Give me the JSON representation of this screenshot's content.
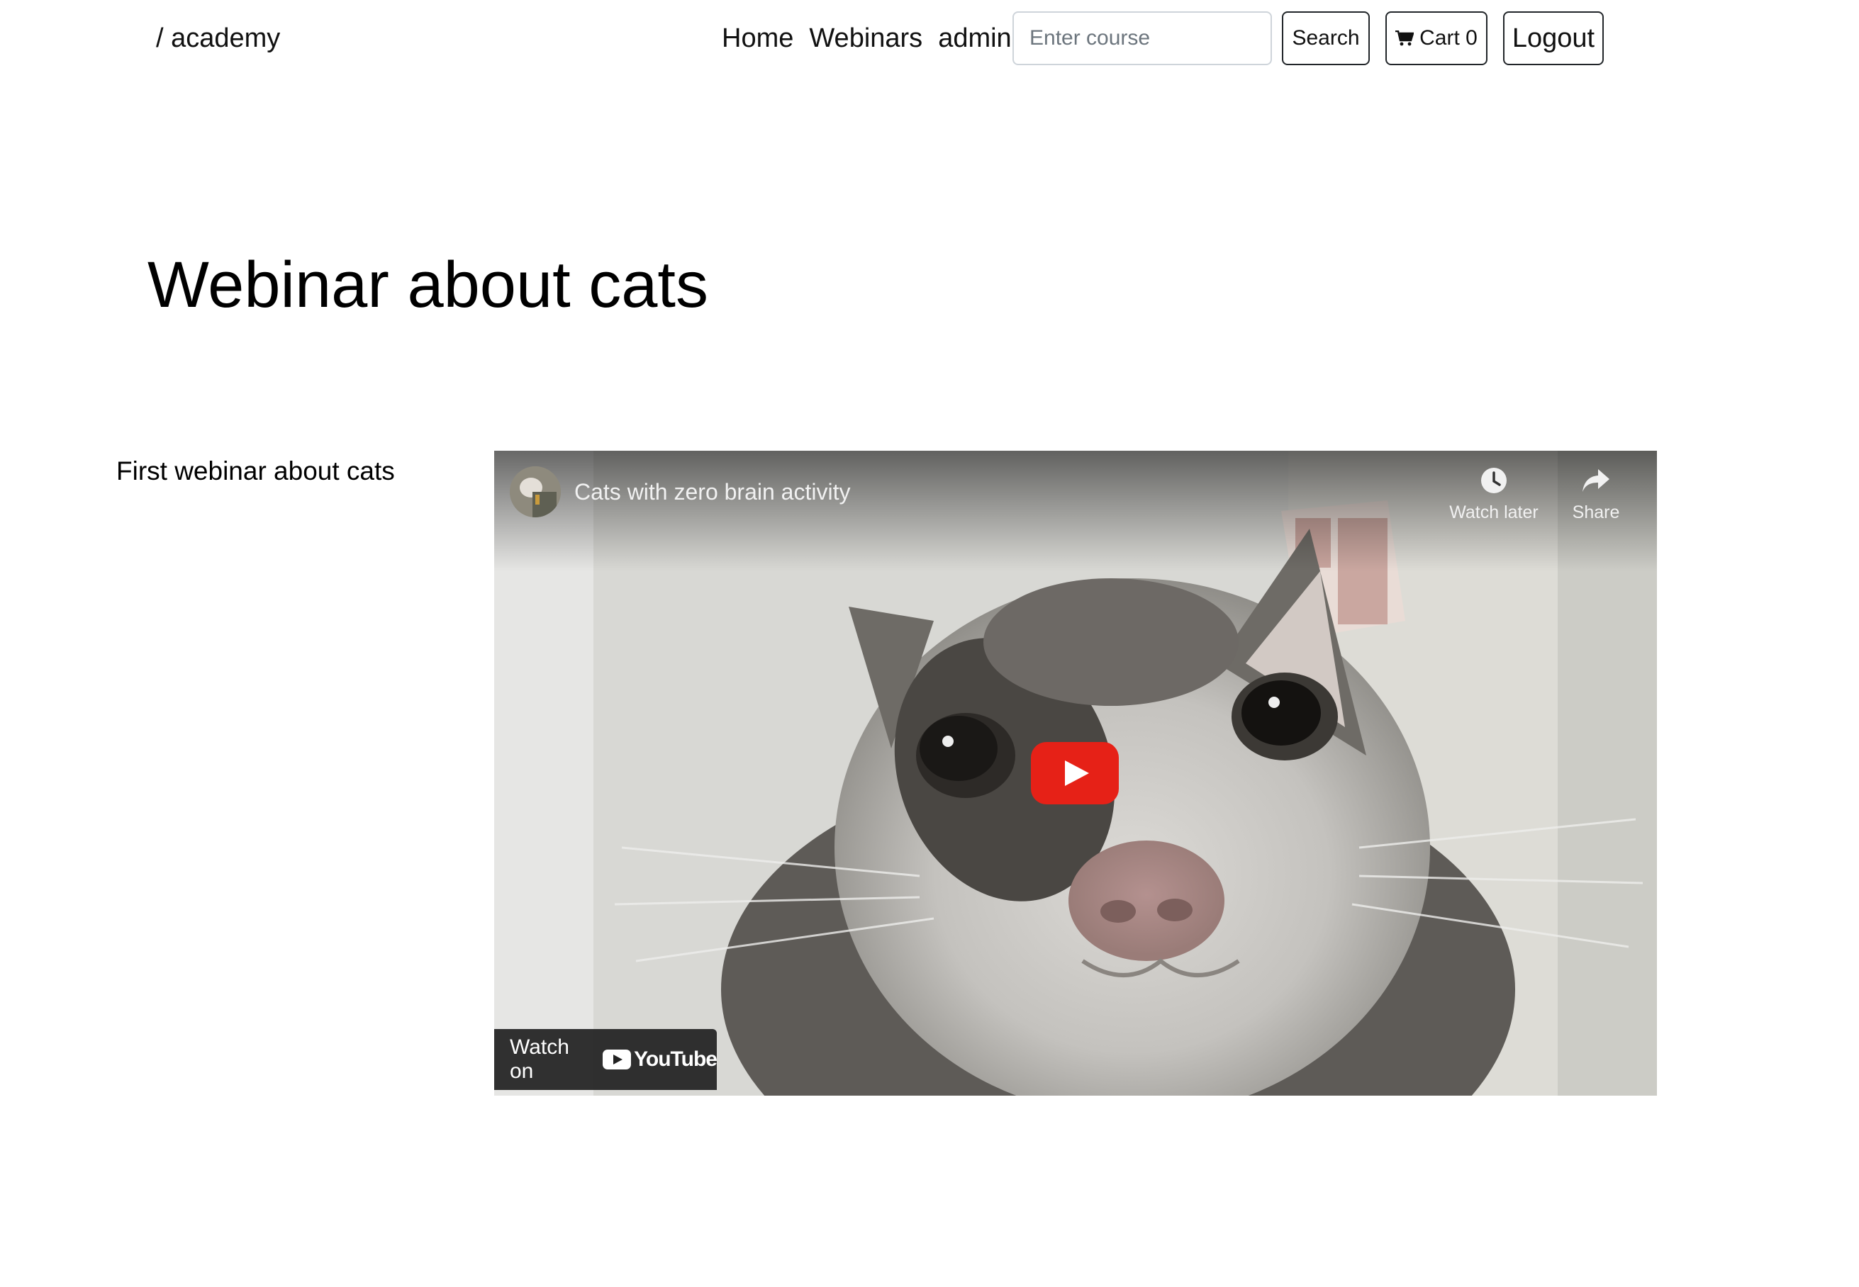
{
  "navbar": {
    "brand": "/ academy",
    "links": [
      "Home",
      "Webinars",
      "admin"
    ],
    "search_placeholder": "Enter course",
    "search_label": "Search",
    "cart_label": "Cart 0",
    "logout_label": "Logout"
  },
  "main": {
    "title": "Webinar about cats",
    "webinar_description": "First webinar about cats"
  },
  "video": {
    "title": "Cats with zero brain activity",
    "watch_later_label": "Watch later",
    "share_label": "Share",
    "watch_on_label": "Watch on",
    "youtube_label": "YouTube",
    "icons": {
      "play": "play-icon",
      "watch_later": "clock-icon",
      "share": "share-arrow-icon",
      "cart": "cart-icon"
    },
    "colors": {
      "play_button": "#e62117",
      "watch_on_bg": "#212121"
    }
  }
}
